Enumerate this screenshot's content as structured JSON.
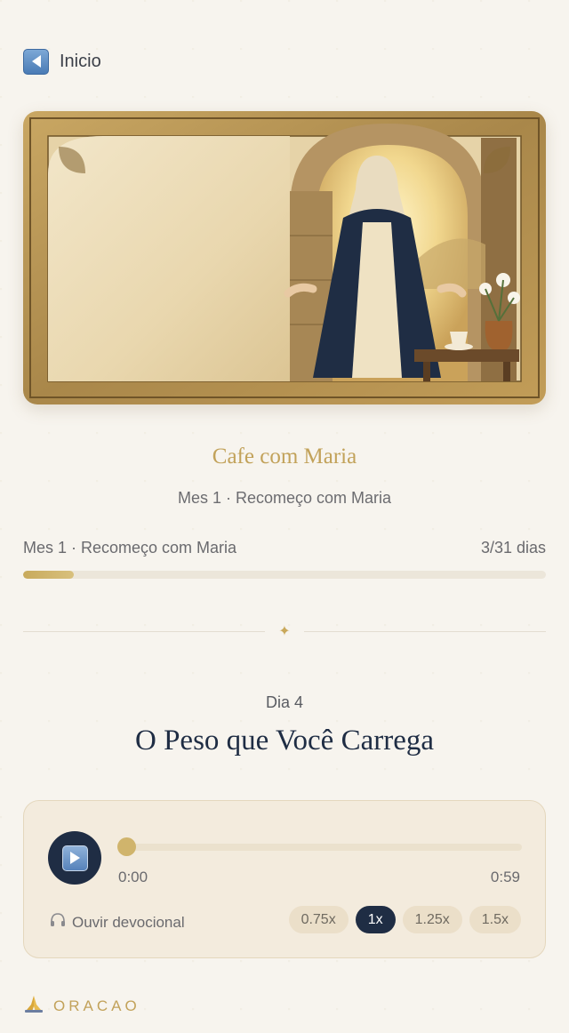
{
  "nav": {
    "back_label": "Inicio",
    "back_icon": "back-arrow-icon"
  },
  "hero": {
    "image": "illustration-virgin-mary-arch"
  },
  "series": {
    "title": "Cafe com Maria",
    "subtitle": "Mes 1 · Recomeço com Maria"
  },
  "progress": {
    "label": "Mes 1 · Recomeço com Maria",
    "count": "3/31 dias",
    "fraction": 0.097
  },
  "devotional": {
    "day_label": "Dia 4",
    "title": "O Peso que Você Carrega"
  },
  "player": {
    "play_icon": "play-icon",
    "position_fraction": 0.0,
    "time_current": "0:00",
    "time_total": "0:59",
    "listen_label": "Ouvir devocional",
    "listen_icon": "headphones-icon",
    "speeds": [
      "0.75x",
      "1x",
      "1.25x",
      "1.5x"
    ],
    "selected_speed": "1x"
  },
  "section": {
    "label": "ORACAO",
    "icon": "praying-hands-icon"
  },
  "colors": {
    "accent_gold": "#c2a25a",
    "navy": "#1f2d44",
    "background": "#f7f4ee"
  }
}
